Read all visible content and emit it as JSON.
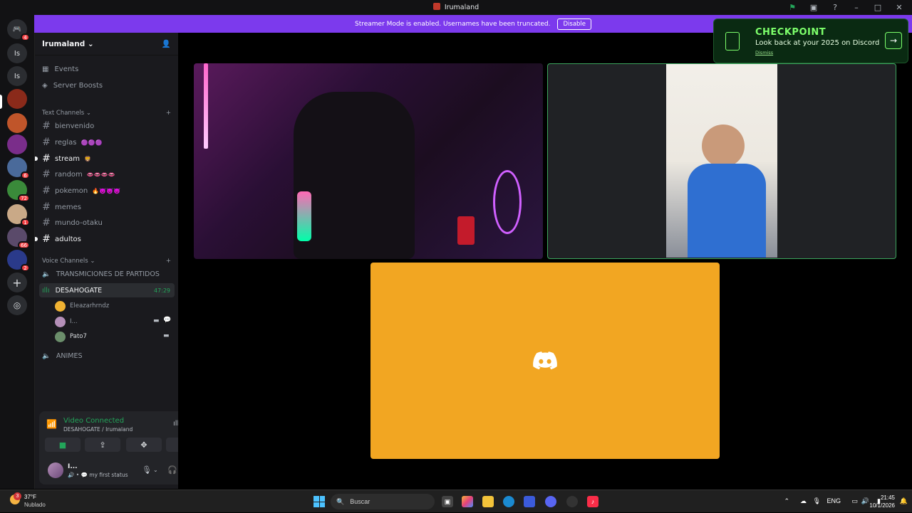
{
  "window": {
    "title": "Irumaland"
  },
  "banner": {
    "text": "Streamer Mode is enabled. Usernames have been truncated.",
    "button": "Disable"
  },
  "servers": [
    {
      "label": "Is",
      "badge": ""
    },
    {
      "label": "Is",
      "badge": ""
    },
    {
      "label": "",
      "badge": ""
    },
    {
      "label": "",
      "badge": ""
    },
    {
      "label": "",
      "badge": ""
    },
    {
      "label": "",
      "badge": "6"
    },
    {
      "label": "",
      "badge": "72"
    },
    {
      "label": "",
      "badge": "1"
    },
    {
      "label": "",
      "badge": "66"
    },
    {
      "label": "",
      "badge": "2"
    }
  ],
  "home_badge": "4",
  "server_name": "Irumaland",
  "nav": {
    "events": "Events",
    "boosts": "Server Boosts"
  },
  "categories": {
    "text": "Text Channels",
    "voice": "Voice Channels"
  },
  "text_channels": [
    {
      "name": "bienvenido",
      "emoji": ""
    },
    {
      "name": "reglas",
      "emoji": "🟣🟣🟣"
    },
    {
      "name": "stream",
      "emoji": "🦁"
    },
    {
      "name": "random",
      "emoji": "👄👄👄👄"
    },
    {
      "name": "pokemon",
      "emoji": "🔥👿👿👿"
    },
    {
      "name": "memes",
      "emoji": ""
    },
    {
      "name": "mundo-otaku",
      "emoji": ""
    },
    {
      "name": "adultos",
      "emoji": ""
    }
  ],
  "voice_channels": [
    {
      "name": "TRANSMICIONES DE PARTIDOS",
      "time": ""
    },
    {
      "name": "DESAHOGATE",
      "time": "47:29"
    },
    {
      "name": "ANIMES",
      "time": ""
    }
  ],
  "voice_members": [
    {
      "name": "Eleazarhrndz",
      "color": "#f0b232"
    },
    {
      "name": "I...",
      "color": "#b48fb8"
    },
    {
      "name": "Pato7",
      "color": "#6b8e6b"
    }
  ],
  "connection": {
    "status": "Video Connected",
    "location": "DESAHOGATE / Irumaland"
  },
  "user": {
    "name": "I...",
    "status": "my first status"
  },
  "promo": {
    "title": "CHECKPOINT",
    "subtitle": "Look back at your 2025 on Discord",
    "dismiss": "Dismiss"
  },
  "taskbar": {
    "temp": "37°F",
    "condition": "Nublado",
    "weather_badge": "3",
    "search": "Buscar",
    "lang": "ENG",
    "time": "21:45",
    "date": "10/1/2026"
  },
  "colors": {
    "accent": "#7c3aed",
    "online": "#23a55a",
    "stage_tile": "#f2a622"
  }
}
